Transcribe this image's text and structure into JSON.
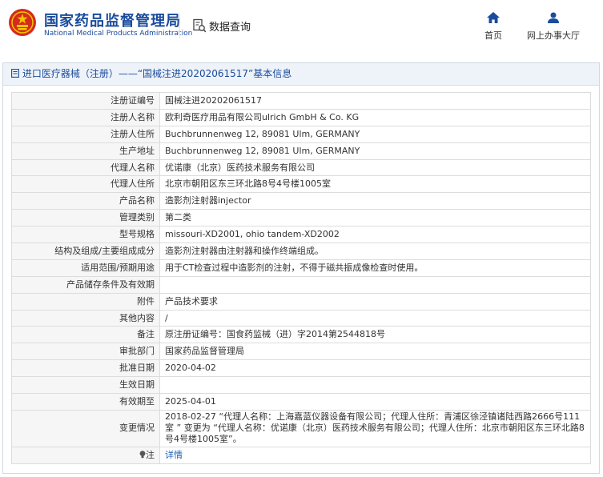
{
  "header": {
    "site_title": "国家药品监督管理局",
    "site_subtitle": "National Medical Products Administration",
    "db_query_label": "数据查询",
    "nav_home": "首页",
    "nav_hall": "网上办事大厅",
    "brand_color": "#1a4b9c",
    "logo_color": "#d52b1e"
  },
  "panel": {
    "title": "进口医疗器械（注册）——“国械注进20202061517”基本信息"
  },
  "rows": [
    {
      "label": "注册证编号",
      "value": "国械注进20202061517"
    },
    {
      "label": "注册人名称",
      "value": "欧利奇医疗用品有限公司ulrich GmbH & Co. KG"
    },
    {
      "label": "注册人住所",
      "value": "Buchbrunnenweg 12, 89081 Ulm, GERMANY"
    },
    {
      "label": "生产地址",
      "value": "Buchbrunnenweg 12, 89081 Ulm, GERMANY"
    },
    {
      "label": "代理人名称",
      "value": "优诺康（北京）医药技术服务有限公司"
    },
    {
      "label": "代理人住所",
      "value": "北京市朝阳区东三环北路8号4号楼1005室"
    },
    {
      "label": "产品名称",
      "value": "造影剂注射器injector"
    },
    {
      "label": "管理类别",
      "value": "第二类"
    },
    {
      "label": "型号规格",
      "value": "missouri-XD2001, ohio tandem-XD2002"
    },
    {
      "label": "结构及组成/主要组成成分",
      "value": "造影剂注射器由注射器和操作终端组成。"
    },
    {
      "label": "适用范围/预期用途",
      "value": "用于CT检查过程中造影剂的注射，不得于磁共振成像检查时使用。"
    },
    {
      "label": "产品储存条件及有效期",
      "value": ""
    },
    {
      "label": "附件",
      "value": "产品技术要求"
    },
    {
      "label": "其他内容",
      "value": "/"
    },
    {
      "label": "备注",
      "value": "原注册证编号：国食药监械（进）字2014第2544818号"
    },
    {
      "label": "审批部门",
      "value": "国家药品监督管理局"
    },
    {
      "label": "批准日期",
      "value": "2020-04-02"
    },
    {
      "label": "生效日期",
      "value": ""
    },
    {
      "label": "有效期至",
      "value": "2025-04-01"
    },
    {
      "label": "变更情况",
      "value": "2018-02-27 “代理人名称：上海嘉蓝仪器设备有限公司；代理人住所：青浦区徐泾镇诸陆西路2666号111室 ” 变更为 “代理人名称：优诺康（北京）医药技术服务有限公司；代理人住所：北京市朝阳区东三环北路8号4号楼1005室”。"
    }
  ],
  "note": {
    "label": "注",
    "link": "详情"
  }
}
